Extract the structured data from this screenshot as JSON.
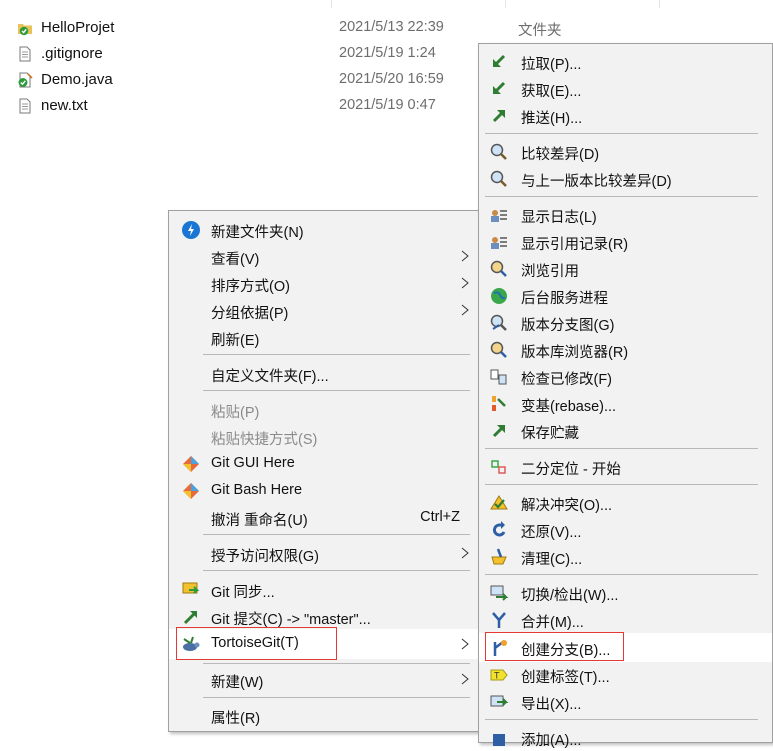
{
  "files": [
    {
      "name": "HelloProjet",
      "date": "2021/5/13 22:39",
      "type": "文件夹",
      "icon": "folder-git-icon"
    },
    {
      "name": ".gitignore",
      "date": "2021/5/19 1:24",
      "type": "",
      "icon": "text-file-icon"
    },
    {
      "name": "Demo.java",
      "date": "2021/5/20 16:59",
      "type": "",
      "icon": "modified-java-file-icon"
    },
    {
      "name": "new.txt",
      "date": "2021/5/19 0:47",
      "type": "",
      "icon": "text-file-icon"
    }
  ],
  "left_menu": {
    "new_folder": "新建文件夹(N)",
    "view": "查看(V)",
    "sort": "排序方式(O)",
    "group": "分组依据(P)",
    "refresh": "刷新(E)",
    "customize": "自定义文件夹(F)...",
    "paste": "粘贴(P)",
    "paste_shortcut": "粘贴快捷方式(S)",
    "git_gui": "Git GUI Here",
    "git_bash": "Git Bash Here",
    "undo_rename": "撤消 重命名(U)",
    "undo_shortcut": "Ctrl+Z",
    "grant_access": "授予访问权限(G)",
    "git_sync": "Git 同步...",
    "git_commit": "Git 提交(C) -> \"master\"...",
    "tortoisegit": "TortoiseGit(T)",
    "new": "新建(W)",
    "properties": "属性(R)"
  },
  "right_menu": {
    "pull": "拉取(P)...",
    "fetch": "获取(E)...",
    "push": "推送(H)...",
    "diff": "比较差异(D)",
    "diff_prev": "与上一版本比较差异(D)",
    "show_log": "显示日志(L)",
    "show_reflog": "显示引用记录(R)",
    "browse_refs": "浏览引用",
    "daemon": "后台服务进程",
    "revision_graph": "版本分支图(G)",
    "repo_browser": "版本库浏览器(R)",
    "check_mods": "检查已修改(F)",
    "rebase": "变基(rebase)...",
    "stash_save": "保存贮藏",
    "bisect": "二分定位 - 开始",
    "resolve": "解决冲突(O)...",
    "revert": "还原(V)...",
    "cleanup": "清理(C)...",
    "switch": "切换/检出(W)...",
    "merge": "合并(M)...",
    "create_branch": "创建分支(B)...",
    "create_tag": "创建标签(T)...",
    "export": "导出(X)...",
    "add": "添加(A)..."
  }
}
